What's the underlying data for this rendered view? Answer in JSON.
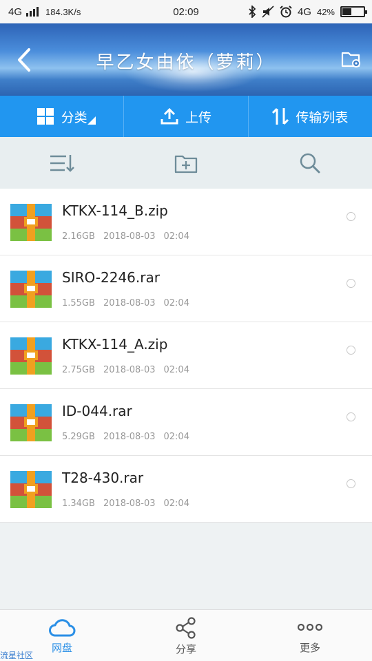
{
  "status_bar": {
    "network": "4G",
    "speed": "184.3K/s",
    "time": "02:09",
    "network_right": "4G",
    "battery_percent": "42%",
    "battery_level": 0.42,
    "icons": [
      "bluetooth-icon",
      "mute-icon",
      "alarm-icon"
    ]
  },
  "header": {
    "title": "早乙女由依（萝莉）",
    "back_icon": "back-arrow-icon",
    "settings_icon": "folder-settings-icon"
  },
  "tabs": [
    {
      "label": "分类",
      "icon": "grid-icon"
    },
    {
      "label": "上传",
      "icon": "upload-icon"
    },
    {
      "label": "传输列表",
      "icon": "transfer-icon"
    }
  ],
  "toolbar": {
    "icons": [
      "sort-icon",
      "new-folder-icon",
      "search-icon"
    ]
  },
  "files": [
    {
      "name": "KTKX-114_B.zip",
      "size": "2.16GB",
      "date": "2018-08-03",
      "time": "02:04"
    },
    {
      "name": "SIRO-2246.rar",
      "size": "1.55GB",
      "date": "2018-08-03",
      "time": "02:04"
    },
    {
      "name": "KTKX-114_A.zip",
      "size": "2.75GB",
      "date": "2018-08-03",
      "time": "02:04"
    },
    {
      "name": "ID-044.rar",
      "size": "5.29GB",
      "date": "2018-08-03",
      "time": "02:04"
    },
    {
      "name": "T28-430.rar",
      "size": "1.34GB",
      "date": "2018-08-03",
      "time": "02:04"
    }
  ],
  "bottom_nav": [
    {
      "label": "网盘",
      "icon": "cloud-icon",
      "active": true
    },
    {
      "label": "分享",
      "icon": "share-icon",
      "active": false
    },
    {
      "label": "更多",
      "icon": "more-icon",
      "active": false
    }
  ],
  "watermark": "流星社区",
  "colors": {
    "accent": "#2196f0",
    "nav_active": "#2a8fe6",
    "archive_blue": "#3aa9e0",
    "archive_red": "#d2523a",
    "archive_green": "#7ac143",
    "archive_orange": "#f0a020"
  }
}
